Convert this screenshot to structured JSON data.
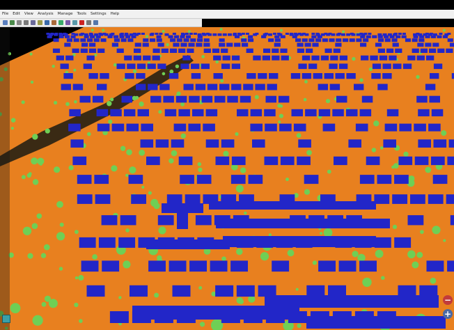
{
  "menu": [
    "File",
    "Edit",
    "View",
    "Analysis",
    "Manage",
    "Tools",
    "Settings",
    "Help"
  ],
  "toolbar": {
    "buttons": [
      {
        "icon": "open-icon",
        "color": "#5a7fbf"
      },
      {
        "icon": "save-icon",
        "color": "#4a8a4a"
      },
      {
        "icon": "select-icon",
        "color": "#888888"
      },
      {
        "icon": "pan-icon",
        "color": "#7a7a7a"
      },
      {
        "icon": "rotate-icon",
        "color": "#6a6a9a"
      },
      {
        "icon": "measure-icon",
        "color": "#9a9a4a"
      },
      {
        "icon": "layer-icon",
        "color": "#3a6aaa"
      },
      {
        "icon": "filter-icon",
        "color": "#aa6a3a"
      },
      {
        "icon": "classify-icon",
        "color": "#3aaa6a"
      },
      {
        "icon": "view-top-icon",
        "color": "#7a5aaa"
      },
      {
        "icon": "view-side-icon",
        "color": "#5a9aaa"
      },
      {
        "icon": "record-icon",
        "color": "#cc2222"
      },
      {
        "icon": "settings-icon",
        "color": "#777777"
      },
      {
        "icon": "help-icon",
        "color": "#5577aa"
      }
    ]
  },
  "point_cloud": {
    "ground_color": "#e8801f",
    "building_color": "#2226c8",
    "vegetation_color": "#6fcf55",
    "background_color": "#000000"
  },
  "nav_controls": {
    "zoom_in": "+",
    "zoom_out": "−"
  }
}
